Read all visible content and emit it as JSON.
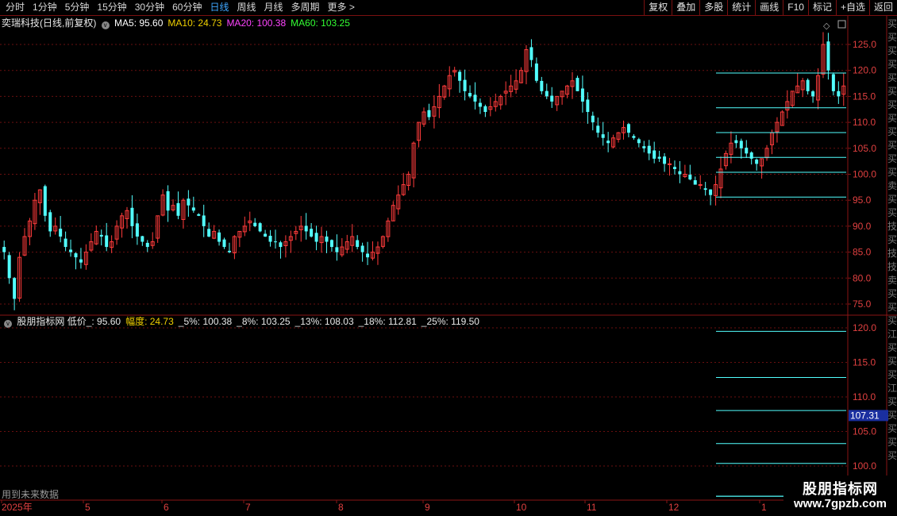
{
  "toolbar": {
    "periods": [
      "分时",
      "1分钟",
      "5分钟",
      "15分钟",
      "30分钟",
      "60分钟",
      "日线",
      "周线",
      "月线",
      "多周期",
      "更多 >"
    ],
    "active_period": "日线",
    "actions": [
      "复权",
      "叠加",
      "多股",
      "统计",
      "画线",
      "F10",
      "标记",
      "+自选",
      "返回"
    ]
  },
  "main_chart": {
    "stock_title": "奕瑞科技(日线,前复权)",
    "ma": [
      {
        "label": "MA5: 95.60",
        "color": "#ffffff"
      },
      {
        "label": "MA10: 24.73",
        "color": "#f0d000"
      },
      {
        "label": "MA20: 100.38",
        "color": "#ff44ff"
      },
      {
        "label": "MA60: 103.25",
        "color": "#33ff33"
      }
    ],
    "y_ticks": [
      "125.0",
      "120.0",
      "115.0",
      "110.0",
      "105.0",
      "100.0",
      "95.0",
      "90.0",
      "85.0",
      "80.0",
      "75.0"
    ]
  },
  "sub_chart": {
    "indicator_name": "股朋指标网",
    "values": [
      {
        "label": "低价_: 95.60",
        "color": "#e8e8e8"
      },
      {
        "label": "幅度: 24.73",
        "color": "#f0d000"
      },
      {
        "label": "_5%: 100.38",
        "color": "#e8e8e8"
      },
      {
        "label": "_8%: 103.25",
        "color": "#e8e8e8"
      },
      {
        "label": "_13%: 108.03",
        "color": "#e8e8e8"
      },
      {
        "label": "_18%: 112.81",
        "color": "#e8e8e8"
      },
      {
        "label": "_25%: 119.50",
        "color": "#e8e8e8"
      }
    ],
    "y_ticks": [
      "120.0",
      "115.0",
      "110.0",
      "105.0",
      "100.0"
    ],
    "cursor_value": "107.31",
    "footer_note": "用到未来数据"
  },
  "x_axis": {
    "labels": [
      "2025年",
      "5",
      "6",
      "7",
      "8",
      "9",
      "10",
      "11",
      "12",
      "1"
    ]
  },
  "right_strip_text": "买买买买买买买买买买买买卖买买技买技技卖买买买江买买买江买买买买买",
  "watermark": {
    "line1": "股朋指标网",
    "line2": "www.7gpzb.com"
  },
  "colors": {
    "up": "#ff3b3b",
    "down": "#52ffff",
    "grid": "#6a0f0f",
    "level": "#52ffff"
  },
  "chart_data": {
    "type": "candlestick",
    "period": "daily",
    "ylim": [
      73,
      128
    ],
    "levels": [
      95.6,
      100.38,
      103.25,
      108.03,
      112.81,
      119.5
    ],
    "closes": [
      85,
      80,
      76,
      84,
      88,
      91,
      95,
      97,
      92,
      89,
      90,
      88,
      86,
      85,
      84,
      83,
      85,
      87,
      89,
      88,
      86,
      87,
      90,
      92,
      93,
      90,
      88,
      87,
      86,
      87,
      92,
      96,
      93,
      94,
      92,
      95,
      94,
      93,
      92,
      90,
      88,
      89,
      87,
      86,
      85,
      88,
      89,
      90,
      91,
      90,
      89,
      88,
      87,
      87,
      86,
      87,
      88,
      89,
      90,
      89,
      88,
      87,
      88,
      87,
      86,
      85,
      86,
      87,
      88,
      86,
      85,
      84,
      85,
      86,
      88,
      91,
      94,
      96,
      98,
      100,
      106,
      110,
      112,
      111,
      113,
      115,
      117,
      119,
      120,
      118,
      116,
      115,
      114,
      113,
      112,
      113,
      114,
      115,
      116,
      117,
      118,
      120,
      124,
      122,
      118,
      116,
      115,
      114,
      115,
      116,
      117,
      118,
      116,
      114,
      112,
      110,
      108,
      107,
      106,
      107,
      108,
      109,
      108,
      107,
      106,
      105,
      104,
      103,
      103,
      102,
      102,
      101,
      100,
      100,
      99,
      98,
      98,
      97,
      96,
      98,
      101,
      104,
      106,
      106,
      105,
      104,
      103,
      102,
      103,
      105,
      108,
      110,
      112,
      114,
      116,
      117,
      118,
      116,
      115,
      119,
      125,
      120,
      116,
      115,
      117
    ]
  }
}
